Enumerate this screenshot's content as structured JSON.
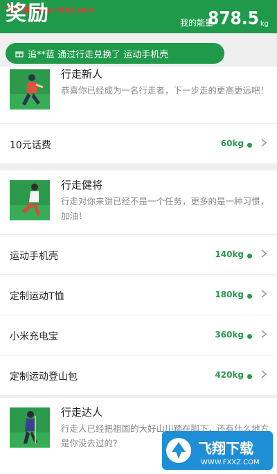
{
  "watermark_top": "飞翔下载 www.FXXZ.com",
  "header": {
    "title": "奖励",
    "energy_label": "我的能量",
    "energy_value": "878.5",
    "energy_unit": "kg"
  },
  "notice": {
    "text": "追**蓝 通过行走兑换了 运动手机壳"
  },
  "sections": [
    {
      "title": "行走新人",
      "desc": "恭喜你已经成为一名行走者，下一步走的更高更远吧！",
      "items": [
        {
          "name": "10元话费",
          "cost": "60kg"
        }
      ]
    },
    {
      "title": "行走健将",
      "desc": "行走对你来讲已经不是一个任务，更多的是一种习惯，加油！",
      "items": [
        {
          "name": "运动手机壳",
          "cost": "140kg"
        },
        {
          "name": "定制运动T恤",
          "cost": "180kg"
        },
        {
          "name": "小米充电宝",
          "cost": "360kg"
        },
        {
          "name": "定制运动登山包",
          "cost": "420kg"
        }
      ]
    },
    {
      "title": "行走达人",
      "desc": "行走人已经把祖国的大好山川踏在脚下，还有什么地方是你没去过的？",
      "items": []
    }
  ],
  "colors": {
    "brand": "#1f9a4a",
    "cost": "#2b9a4c"
  }
}
